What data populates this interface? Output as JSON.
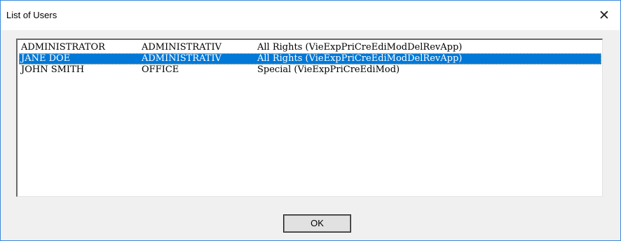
{
  "window": {
    "title": "List of Users",
    "close_glyph": "✕",
    "close_icon": "close-icon"
  },
  "users": [
    {
      "name": "ADMINISTRATOR",
      "group": "ADMINISTRATIV",
      "rights": "All Rights (VieExpPriCreEdiModDelRevApp)",
      "selected": false
    },
    {
      "name": "JANE DOE",
      "group": "ADMINISTRATIV",
      "rights": "All Rights (VieExpPriCreEdiModDelRevApp)",
      "selected": true
    },
    {
      "name": "JOHN SMITH",
      "group": "OFFICE",
      "rights": "Special (VieExpPriCreEdiMod)",
      "selected": false
    }
  ],
  "buttons": {
    "ok_label": "OK"
  },
  "colors": {
    "selection": "#0078d7",
    "window_border": "#3b8ad9",
    "dialog_background": "#f0f0f0"
  }
}
